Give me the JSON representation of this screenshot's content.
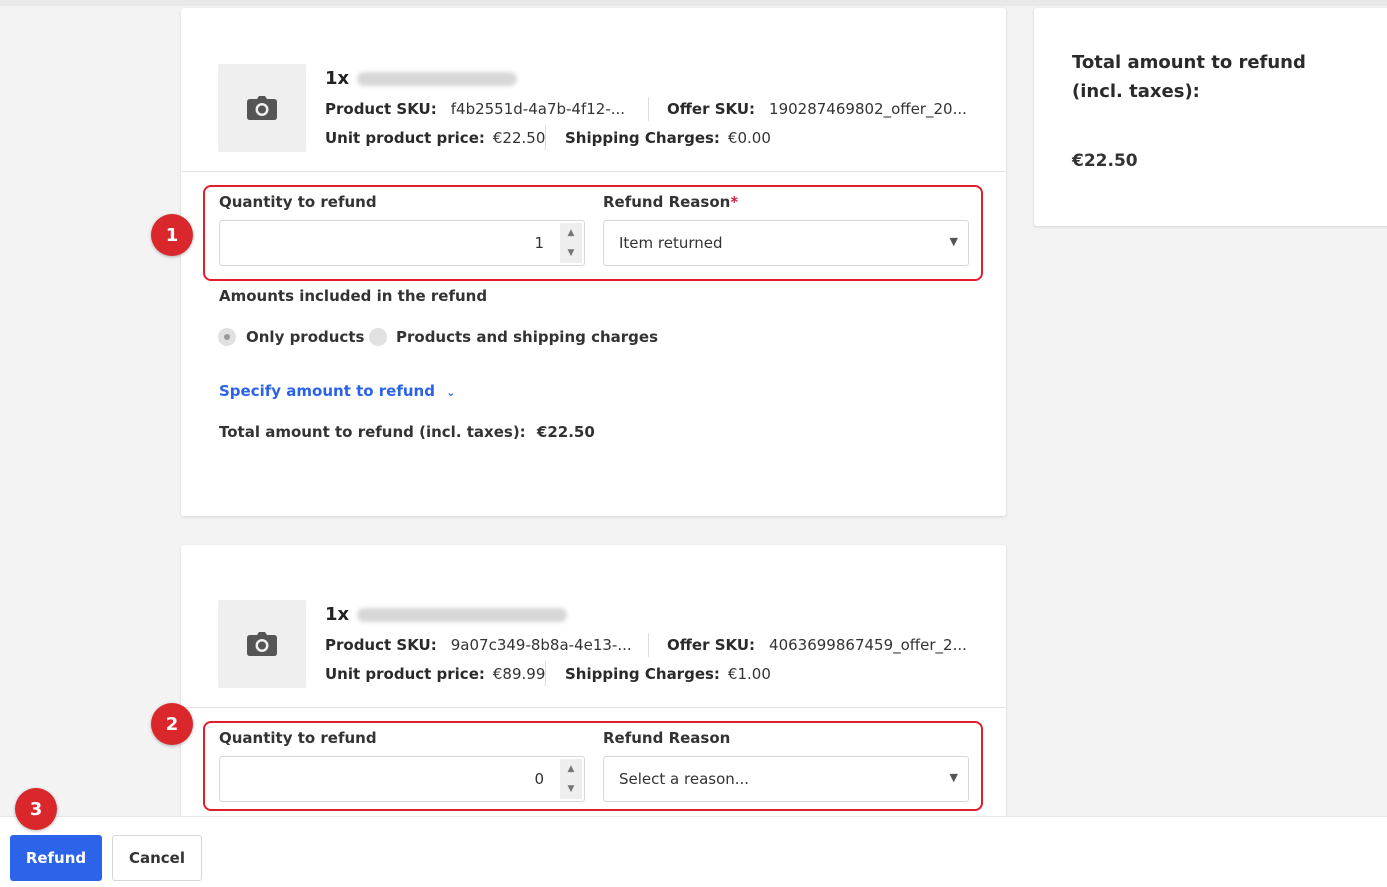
{
  "items": [
    {
      "quantity_prefix": "1x",
      "product_sku_label": "Product SKU:",
      "product_sku": "f4b2551d-4a7b-4f12-...",
      "offer_sku_label": "Offer SKU:",
      "offer_sku": "190287469802_offer_20...",
      "unit_price_label": "Unit product price:",
      "unit_price": "€22.50",
      "shipping_label": "Shipping Charges:",
      "shipping": "€0.00",
      "qty_label": "Quantity to refund",
      "qty_value": "1",
      "reason_label": "Refund Reason",
      "reason_required": "*",
      "reason_value": "Item returned",
      "amounts_label": "Amounts included in the refund",
      "option_only_products": "Only products",
      "option_products_shipping": "Products and shipping charges",
      "specify_link": "Specify amount to refund",
      "total_label": "Total amount to refund (incl. taxes):",
      "total_value": "€22.50"
    },
    {
      "quantity_prefix": "1x",
      "product_sku_label": "Product SKU:",
      "product_sku": "9a07c349-8b8a-4e13-...",
      "offer_sku_label": "Offer SKU:",
      "offer_sku": "4063699867459_offer_2...",
      "unit_price_label": "Unit product price:",
      "unit_price": "€89.99",
      "shipping_label": "Shipping Charges:",
      "shipping": "€1.00",
      "qty_label": "Quantity to refund",
      "qty_value": "0",
      "reason_label": "Refund Reason",
      "reason_value": "Select a reason..."
    }
  ],
  "summary": {
    "title": "Total amount to refund (incl. taxes):",
    "amount": "€22.50"
  },
  "annotations": [
    "1",
    "2",
    "3"
  ],
  "footer": {
    "refund_label": "Refund",
    "cancel_label": "Cancel"
  },
  "icons": {
    "product_image": "camera-icon",
    "select_caret": "caret-down-icon",
    "link_chevron": "chevron-down-icon"
  },
  "colors": {
    "primary": "#2c64e9",
    "annotation": "#d9272b",
    "required": "#d4213d"
  }
}
